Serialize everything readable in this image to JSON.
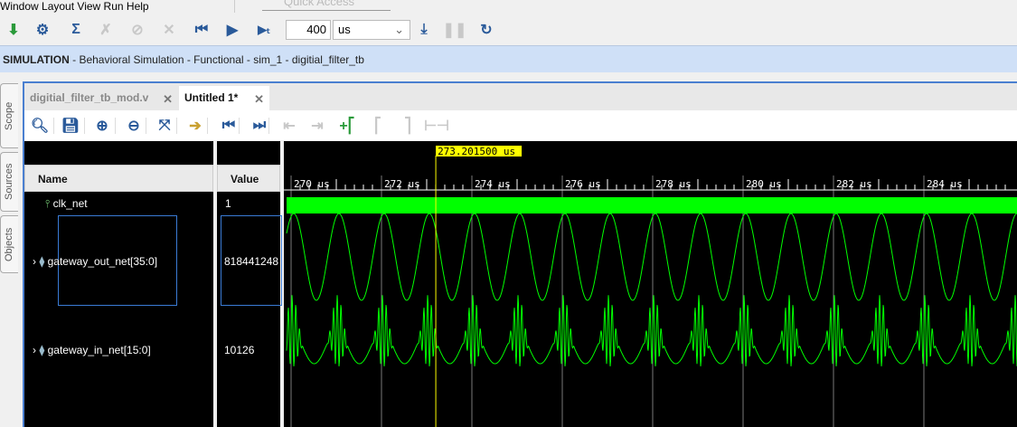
{
  "menu": [
    "Window",
    "Layout",
    "View",
    "Run",
    "Help"
  ],
  "quick_access_placeholder": "Quick Access",
  "toolbar": {
    "run_time": "400",
    "run_unit": "us"
  },
  "sim_bar": {
    "bold": "SIMULATION",
    "rest": " - Behavioral Simulation - Functional - sim_1 - digitial_filter_tb"
  },
  "side_tabs": [
    "Scope",
    "Sources",
    "Objects"
  ],
  "tabs": [
    {
      "label": "digitial_filter_tb_mod.v",
      "active": false
    },
    {
      "label": "Untitled 1*",
      "active": true
    }
  ],
  "columns": {
    "name": "Name",
    "value": "Value"
  },
  "signals": [
    {
      "name": "clk_net",
      "value": "1"
    },
    {
      "name": "gateway_out_net[35:0]",
      "value": "818441248"
    },
    {
      "name": "gateway_in_net[15:0]",
      "value": "10126"
    }
  ],
  "cursor": "273.201500 us",
  "time_ticks": [
    "270 us",
    "272 us",
    "274 us",
    "276 us",
    "278 us",
    "280 us",
    "282 us",
    "284 us"
  ],
  "colors": {
    "wave": "#00ff00",
    "cursor": "#ffff00",
    "accent": "#4a7fd0"
  }
}
